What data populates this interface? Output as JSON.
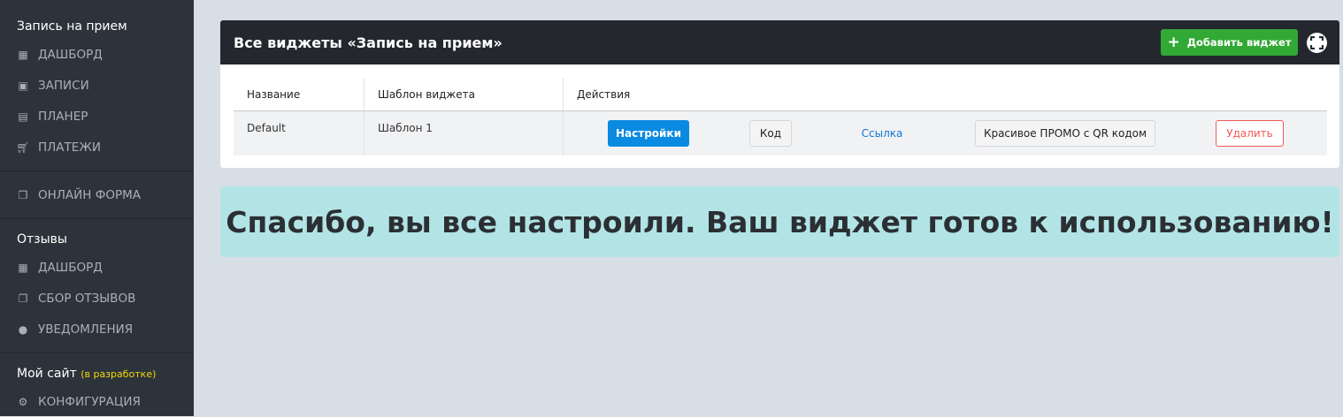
{
  "sidebar": {
    "section1": "Запись на прием",
    "items1": [
      {
        "label": "ДАШБОРД",
        "icon": "dashboard-icon"
      },
      {
        "label": "ЗАПИСИ",
        "icon": "clipboard-icon"
      },
      {
        "label": "ПЛАНЕР",
        "icon": "calendar-icon"
      },
      {
        "label": "ПЛАТЕЖИ",
        "icon": "cart-icon"
      }
    ],
    "online_form": "ОНЛАЙН ФОРМА",
    "section2": "Отзывы",
    "items2": [
      {
        "label": "ДАШБОРД"
      },
      {
        "label": "СБОР ОТЗЫВОВ"
      },
      {
        "label": "УВЕДОМЛЕНИЯ"
      }
    ],
    "section3": "Мой сайт",
    "section3_note": "(в разработке)",
    "config": "КОНФИГУРАЦИЯ"
  },
  "card": {
    "title": "Все виджеты «Запись на прием»",
    "add_button": "Добавить виджет",
    "columns": [
      "Название",
      "Шаблон виджета",
      "Действия"
    ],
    "rows": [
      {
        "name": "Default",
        "template": "Шаблон 1",
        "actions": {
          "settings": "Настройки",
          "code": "Код",
          "link": "Ссылка",
          "promo": "Красивое ПРОМО с QR кодом",
          "delete": "Удалить"
        }
      }
    ]
  },
  "banner": "Спасибо, вы все настроили. Ваш виджет готов к использованию!"
}
